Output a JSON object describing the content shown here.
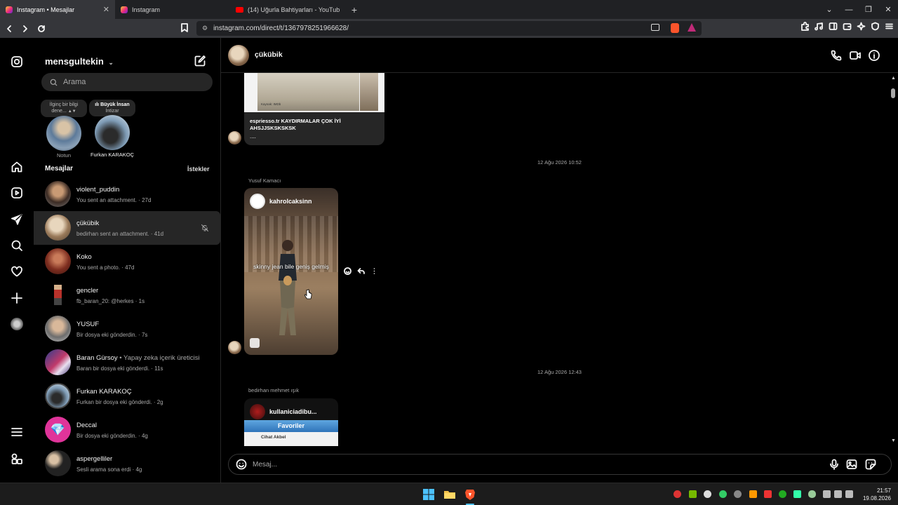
{
  "browser": {
    "tabs": [
      {
        "title": "Instagram • Mesajlar",
        "icon": "instagram-favicon",
        "active": true
      },
      {
        "title": "Instagram",
        "icon": "instagram-favicon",
        "active": false
      },
      {
        "title": "(14) Uğurla Bahtiyarları - YouTube",
        "icon": "youtube-favicon",
        "active": false
      }
    ],
    "url": "instagram.com/direct/t/1367978251966628/",
    "window_controls": [
      "chevron-down-icon",
      "minimize-icon",
      "restore-icon",
      "close-icon"
    ]
  },
  "inbox": {
    "username": "mensgultekin",
    "search_placeholder": "Arama",
    "notes": [
      {
        "bubble": "İlginç bir bilgi dene...",
        "label": "Notun"
      },
      {
        "bubble": "Büyük İnsan",
        "bubble_sub": "İntizar",
        "label": "Furkan KARAKOÇ"
      }
    ],
    "messages_header": "Mesajlar",
    "requests_label": "İstekler",
    "conversations": [
      {
        "name": "violent_puddin",
        "sub": "You sent an attachment. · 27d"
      },
      {
        "name": "çükübik",
        "sub": "bedirhan sent an attachment. · 41d",
        "selected": true,
        "muted": true
      },
      {
        "name": "Koko",
        "sub": "You sent a photo. · 47d"
      },
      {
        "name": "gencler",
        "sub": "fb_baran_20: @herkes · 1s"
      },
      {
        "name": "YUSUF",
        "sub": "Bir dosya eki gönderdin. · 7s"
      },
      {
        "name": "Baran Gürsoy",
        "extra": "• Yapay zeka içerik üreticisi",
        "sub": "Baran bir dosya eki gönderdi. · 11s"
      },
      {
        "name": "Furkan KARAKOÇ",
        "sub": "Furkan bir dosya eki gönderdi. · 2g"
      },
      {
        "name": "Deccal",
        "sub": "Bir dosya eki gönderdin. · 4g"
      },
      {
        "name": "aspergelliler",
        "sub": "Sesli arama sona erdi · 4g"
      }
    ]
  },
  "thread": {
    "name": "çükübik",
    "card1": {
      "caption": "espriesso.tr KAYDIRMALAR ÇOK İYİ AHSJJSKSKSKSK",
      "more": "....",
      "watermark": "Kaynak: IMDb"
    },
    "timestamp1": "12 Ağu 2026 10:52",
    "sender1": "Yusuf Kamacı",
    "reel1": {
      "user": "kahrolcaksinn",
      "caption": "skinny jean bile geniş gelmiş"
    },
    "timestamp2": "12 Ağu 2026 12:43",
    "sender2": "bedirhan mehmet ışık",
    "reel2": {
      "user": "kullaniciadibu...",
      "bar_title": "Favoriler",
      "row_name": "Cihat Akbel"
    },
    "composer_placeholder": "Mesaj..."
  },
  "taskbar": {
    "time": "21:57",
    "date": "19.08.2026"
  }
}
